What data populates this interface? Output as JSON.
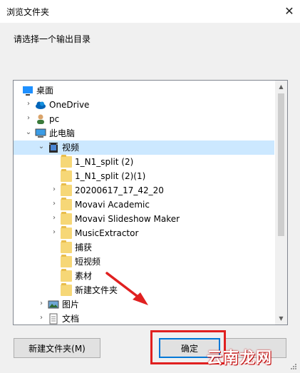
{
  "window": {
    "title": "浏览文件夹",
    "close_glyph": "✕"
  },
  "prompt": "请选择一个输出目录",
  "tree": {
    "rows": [
      {
        "label": "桌面",
        "icon": "desktop-icon",
        "chev": ""
      },
      {
        "label": "OneDrive",
        "icon": "cloud-icon",
        "chev": "›"
      },
      {
        "label": "pc",
        "icon": "user-icon",
        "chev": "›"
      },
      {
        "label": "此电脑",
        "icon": "computer-icon",
        "chev": "⌄"
      },
      {
        "label": "视频",
        "icon": "video-folder-icon",
        "chev": "⌄"
      },
      {
        "label": "1_N1_split (2)",
        "icon": "folder-icon",
        "chev": ""
      },
      {
        "label": "1_N1_split (2)(1)",
        "icon": "folder-icon",
        "chev": ""
      },
      {
        "label": "20200617_17_42_20",
        "icon": "folder-icon",
        "chev": "›"
      },
      {
        "label": "Movavi Academic",
        "icon": "folder-icon",
        "chev": "›"
      },
      {
        "label": "Movavi Slideshow Maker",
        "icon": "folder-icon",
        "chev": "›"
      },
      {
        "label": "MusicExtractor",
        "icon": "folder-icon",
        "chev": "›"
      },
      {
        "label": "捕获",
        "icon": "folder-icon",
        "chev": ""
      },
      {
        "label": "短视频",
        "icon": "folder-icon",
        "chev": ""
      },
      {
        "label": "素材",
        "icon": "folder-icon",
        "chev": ""
      },
      {
        "label": "新建文件夹",
        "icon": "folder-icon",
        "chev": ""
      },
      {
        "label": "图片",
        "icon": "pictures-folder-icon",
        "chev": "›"
      },
      {
        "label": "文档",
        "icon": "documents-folder-icon",
        "chev": "›"
      }
    ],
    "selected_label": "视频"
  },
  "buttons": {
    "new_folder": "新建文件夹(M)",
    "ok": "确定"
  },
  "watermark": "云南龙网",
  "colors": {
    "accent": "#0078d7",
    "highlight": "#e02020",
    "selected_bg": "#cce8ff"
  }
}
